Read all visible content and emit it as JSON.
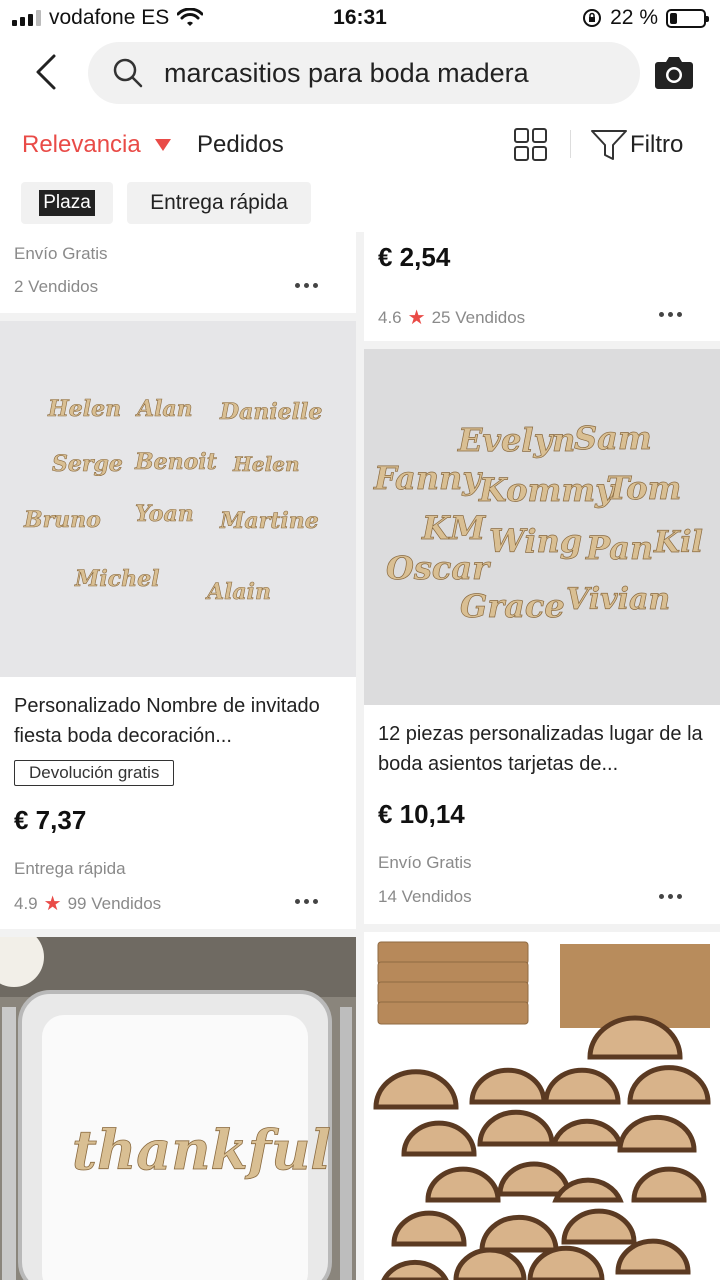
{
  "status_bar": {
    "carrier": "vodafone ES",
    "time": "16:31",
    "battery": "22 %"
  },
  "search": {
    "query": "marcasitios para boda madera"
  },
  "sort": {
    "relevance": "Relevancia",
    "orders": "Pedidos",
    "filter": "Filtro"
  },
  "chips": {
    "plaza": "Plaza",
    "fast_delivery": "Entrega rápida"
  },
  "products": [
    {
      "shipping": "Envío Gratis",
      "sold": "2 Vendidos"
    },
    {
      "price": "€ 2,54",
      "rating": "4.6",
      "sold": "25 Vendidos"
    },
    {
      "title": "Personalizado Nombre de invitado fiesta boda decoración...",
      "badge": "Devolución gratis",
      "price": "€ 7,37",
      "shipping": "Entrega rápida",
      "rating": "4.9",
      "sold": "99 Vendidos",
      "image_words": [
        "Helen",
        "Alan",
        "Danielle",
        "Serge",
        "Benoit",
        "Helen",
        "Bruno",
        "Yoan",
        "Martine",
        "Michel",
        "Alain"
      ]
    },
    {
      "title": "12 piezas personalizadas lugar de la boda asientos tarjetas de...",
      "price": "€ 10,14",
      "shipping": "Envío Gratis",
      "sold": "14 Vendidos",
      "image_words": [
        "Evelyn",
        "Sam",
        "Fanny",
        "Kommy",
        "Tom",
        "KM",
        "Wing",
        "Pan",
        "Kil",
        "Oscar",
        "Grace",
        "Vivian"
      ]
    },
    {
      "image_words": [
        "thankful"
      ]
    },
    {}
  ],
  "colors": {
    "accent": "#e94b47",
    "background": "#f2f2f2",
    "wood": "#d9bf93"
  }
}
